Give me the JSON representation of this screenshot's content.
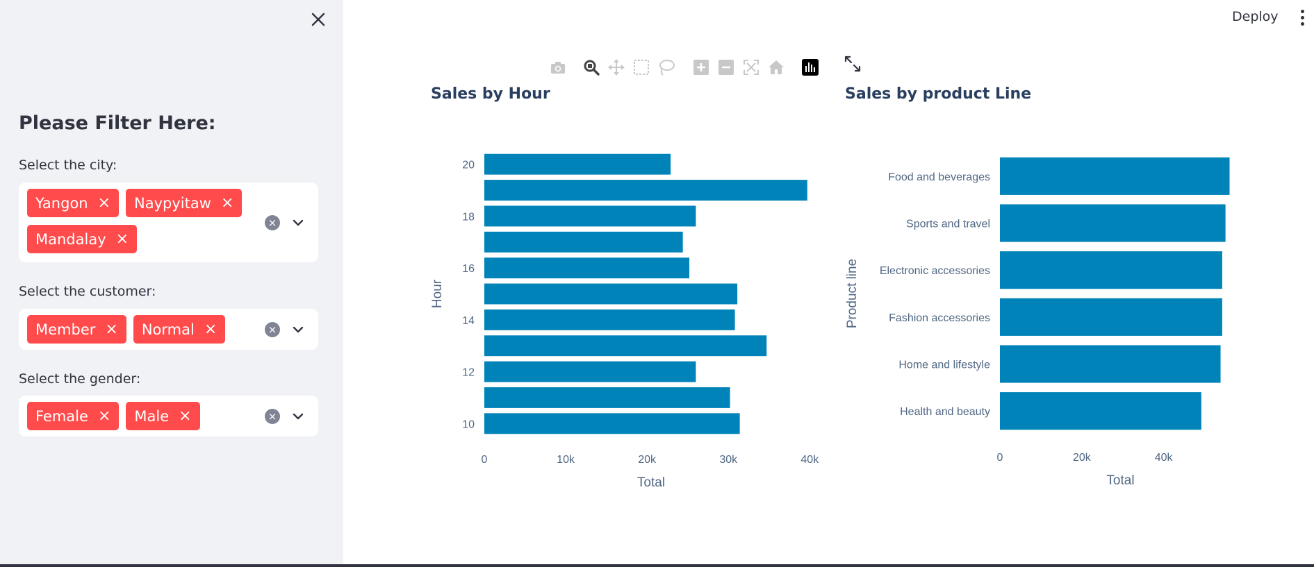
{
  "sidebar": {
    "title": "Please Filter Here:",
    "filters": [
      {
        "label": "Select the city:",
        "tags": [
          "Yangon",
          "Naypyitaw",
          "Mandalay"
        ]
      },
      {
        "label": "Select the customer:",
        "tags": [
          "Member",
          "Normal"
        ]
      },
      {
        "label": "Select the gender:",
        "tags": [
          "Female",
          "Male"
        ]
      }
    ]
  },
  "header": {
    "deploy_label": "Deploy"
  },
  "tag_remove_glyph": "×",
  "clear_glyph": "×",
  "toolbar_icons": [
    "camera-icon",
    "zoom-icon",
    "pan-icon",
    "box-select-icon",
    "lasso-select-icon",
    "zoom-in-icon",
    "zoom-out-icon",
    "autoscale-icon",
    "reset-axes-icon",
    "plotly-logo-icon"
  ],
  "colors": {
    "bar": "#0083b8",
    "tag": "#ff4b4b",
    "sidebar_bg": "#f0f2f6",
    "axis_text": "#506784"
  },
  "chart_data": [
    {
      "type": "bar",
      "orientation": "horizontal",
      "title": "Sales by Hour",
      "xlabel": "Total",
      "ylabel": "Hour",
      "categories": [
        10,
        11,
        12,
        13,
        14,
        15,
        16,
        17,
        18,
        19,
        20
      ],
      "values": [
        31400,
        30200,
        26000,
        34700,
        30800,
        31100,
        25200,
        24400,
        26000,
        39700,
        22900
      ],
      "xlim": [
        0,
        41000
      ],
      "xticks": [
        "0",
        "10k",
        "20k",
        "30k",
        "40k"
      ],
      "xtick_values": [
        0,
        10000,
        20000,
        30000,
        40000
      ],
      "ytick_labels": [
        "10",
        "12",
        "14",
        "16",
        "18",
        "20"
      ],
      "ytick_values": [
        10,
        12,
        14,
        16,
        18,
        20
      ]
    },
    {
      "type": "bar",
      "orientation": "horizontal",
      "title": "Sales by product Line",
      "xlabel": "Total",
      "ylabel": "Product line",
      "categories": [
        "Health and beauty",
        "Home and lifestyle",
        "Fashion accessories",
        "Electronic accessories",
        "Sports and travel",
        "Food and beverages"
      ],
      "values": [
        49200,
        53900,
        54300,
        54300,
        55100,
        56100
      ],
      "xlim": [
        0,
        58900
      ],
      "xticks": [
        "0",
        "20k",
        "40k"
      ],
      "xtick_values": [
        0,
        20000,
        40000
      ]
    }
  ]
}
